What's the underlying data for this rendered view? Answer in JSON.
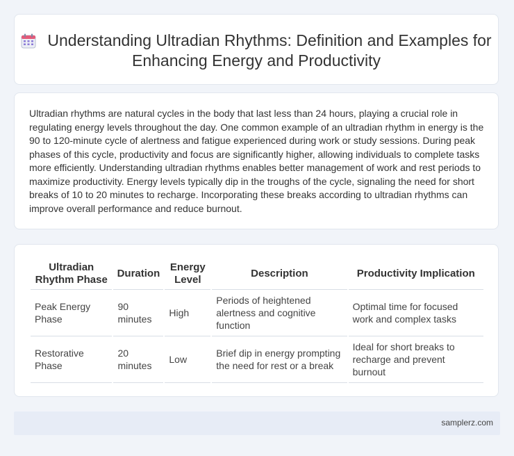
{
  "header": {
    "icon": "calendar-icon",
    "title": "Understanding Ultradian Rhythms: Definition and Examples for Enhancing Energy and Productivity"
  },
  "intro": {
    "text": "Ultradian rhythms are natural cycles in the body that last less than 24 hours, playing a crucial role in regulating energy levels throughout the day. One common example of an ultradian rhythm in energy is the 90 to 120-minute cycle of alertness and fatigue experienced during work or study sessions. During peak phases of this cycle, productivity and focus are significantly higher, allowing individuals to complete tasks more efficiently. Understanding ultradian rhythms enables better management of work and rest periods to maximize productivity. Energy levels typically dip in the troughs of the cycle, signaling the need for short breaks of 10 to 20 minutes to recharge. Incorporating these breaks according to ultradian rhythms can improve overall performance and reduce burnout."
  },
  "table": {
    "headers": [
      "Ultradian Rhythm Phase",
      "Duration",
      "Energy Level",
      "Description",
      "Productivity Implication"
    ],
    "rows": [
      [
        "Peak Energy Phase",
        "90 minutes",
        "High",
        "Periods of heightened alertness and cognitive function",
        "Optimal time for focused work and complex tasks"
      ],
      [
        "Restorative Phase",
        "20 minutes",
        "Low",
        "Brief dip in energy prompting the need for rest or a break",
        "Ideal for short breaks to recharge and prevent burnout"
      ]
    ]
  },
  "footer": {
    "site": "samplerz.com"
  }
}
